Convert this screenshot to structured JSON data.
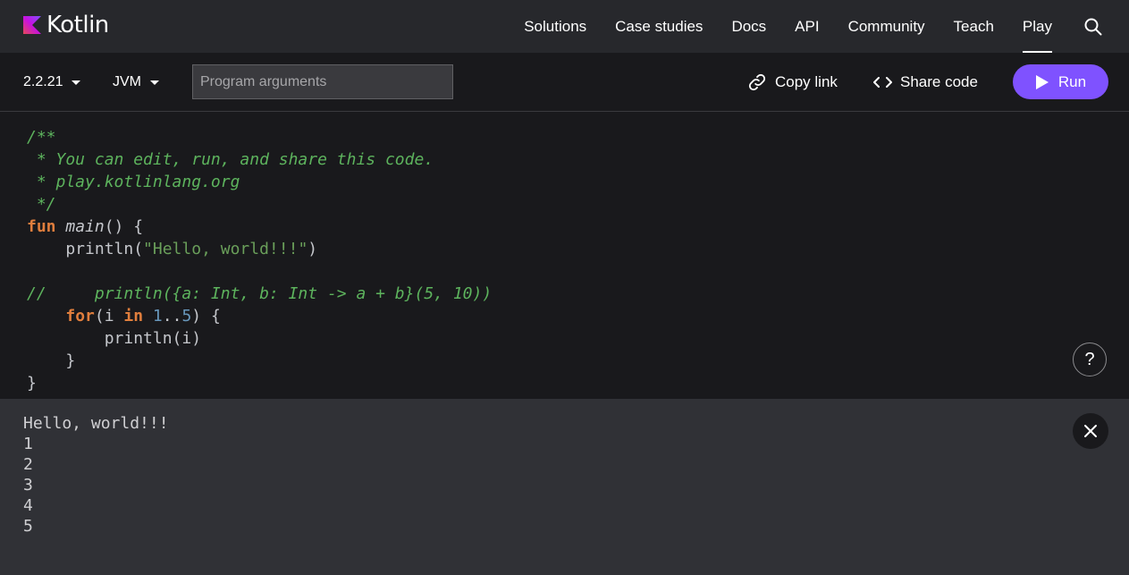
{
  "header": {
    "logo_text": "Kotlin",
    "nav": [
      {
        "label": "Solutions"
      },
      {
        "label": "Case studies"
      },
      {
        "label": "Docs"
      },
      {
        "label": "API"
      },
      {
        "label": "Community"
      },
      {
        "label": "Teach"
      },
      {
        "label": "Play",
        "active": true
      }
    ],
    "search_icon": "search-icon"
  },
  "toolbar": {
    "version": "2.2.21",
    "platform": "JVM",
    "args_placeholder": "Program arguments",
    "args_value": "",
    "copy_link": "Copy link",
    "share_code": "Share code",
    "run": "Run"
  },
  "editor": {
    "lines": [
      "/**",
      " * You can edit, run, and share this code.",
      " * play.kotlinlang.org",
      " */",
      "fun main() {",
      "    println(\"Hello, world!!!\")",
      "",
      "//     println({a: Int, b: Int -> a + b}(5, 10))",
      "    for(i in 1..5) {",
      "        println(i)",
      "    }",
      "}"
    ],
    "help_label": "?"
  },
  "output": {
    "lines": [
      "Hello, world!!!",
      "1",
      "2",
      "3",
      "4",
      "5"
    ]
  },
  "colors": {
    "accent": "#7f52ff",
    "nav_bg": "#27282c",
    "editor_bg": "#19191c",
    "output_bg": "#303136",
    "comment": "#5db35d",
    "keyword": "#e07e3d",
    "string": "#6a9f5a",
    "number": "#6897bb"
  }
}
